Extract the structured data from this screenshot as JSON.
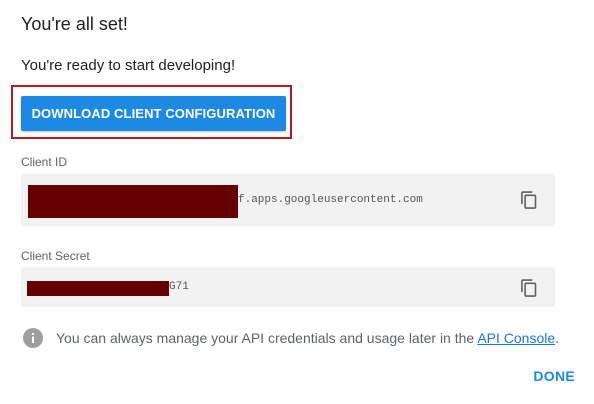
{
  "dialog": {
    "title": "You're all set!",
    "subtitle": "You're ready to start developing!",
    "download_label": "DOWNLOAD CLIENT CONFIGURATION",
    "done_label": "DONE"
  },
  "client_id": {
    "label": "Client ID",
    "value_suffix": "f.apps.googleusercontent.com",
    "copy_icon": "copy-icon"
  },
  "client_secret": {
    "label": "Client Secret",
    "value_suffix": "G71",
    "copy_icon": "copy-icon"
  },
  "info": {
    "icon": "info-icon",
    "text": "You can always manage your API credentials and usage later in the ",
    "link": "API Console",
    "after": "."
  },
  "colors": {
    "accent": "#1e88e5",
    "highlight_border": "#b71c1c",
    "redaction": "#660000",
    "field_bg": "#f2f2f2"
  }
}
